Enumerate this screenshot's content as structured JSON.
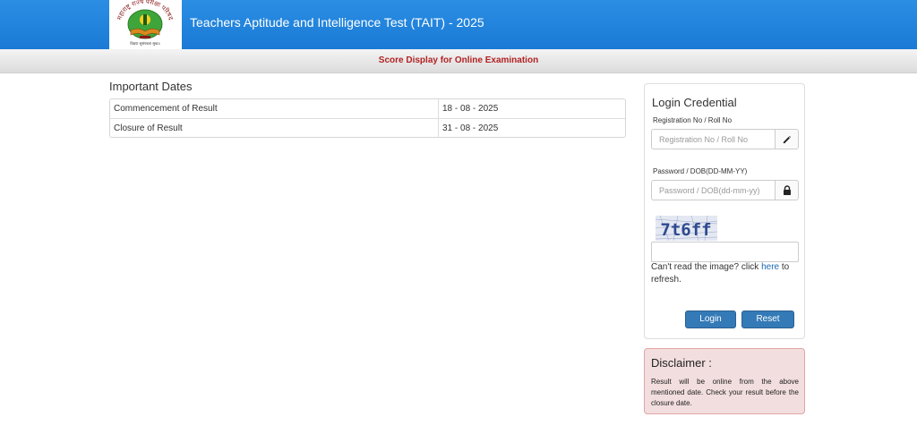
{
  "header": {
    "title": "Teachers Aptitude and Intelligence Test (TAIT) - 2025",
    "logo_top_text": "महाराष्ट्र राज्य परीक्षा परिषद",
    "logo_bottom_text": "विद्यया सुसंपन्नता सुख॥"
  },
  "subbar": {
    "title": "Score Display for Online Examination"
  },
  "important_dates": {
    "heading": "Important Dates",
    "rows": [
      {
        "label": "Commencement of Result",
        "value": "18 - 08 - 2025"
      },
      {
        "label": "Closure of Result",
        "value": "31 - 08 - 2025"
      }
    ]
  },
  "login": {
    "title": "Login Credential",
    "reg_label": "Registration No / Roll No",
    "reg_placeholder": "Registration No / Roll No",
    "reg_icon": "pencil-icon",
    "pwd_label": "Password / DOB(DD-MM-YY)",
    "pwd_placeholder": "Password / DOB(dd-mm-yy)",
    "pwd_icon": "lock-icon",
    "captcha_text": "7t6ff",
    "refresh_prefix": "Can't read the image? click ",
    "refresh_link": "here",
    "refresh_suffix": " to refresh.",
    "login_button": "Login",
    "reset_button": "Reset"
  },
  "disclaimer": {
    "title": "Disclaimer :",
    "text": "Result will be online from the above mentioned date. Check your result before the closure date."
  },
  "colors": {
    "header_blue": "#1a7ad6",
    "subbar_title_red": "#b22222",
    "button_blue": "#337ab7",
    "disclaimer_bg": "#f2dede",
    "disclaimer_border": "#e3a4a4"
  }
}
